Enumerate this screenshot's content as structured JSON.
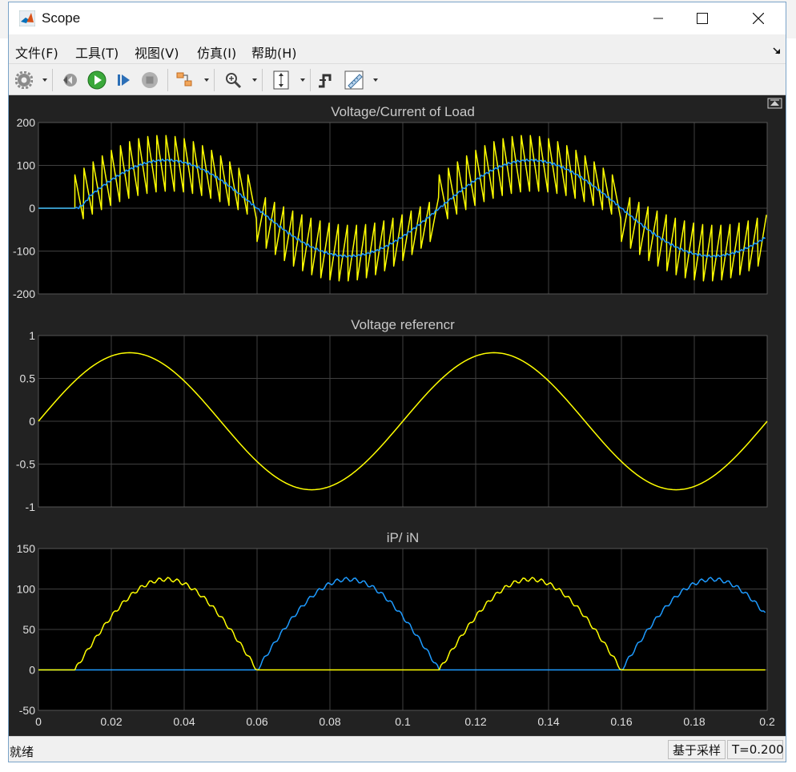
{
  "window": {
    "title": "Scope"
  },
  "menu": [
    "文件(F)",
    "工具(T)",
    "视图(V)",
    "仿真(I)",
    "帮助(H)"
  ],
  "toolbar": {
    "icons": [
      "gear-icon",
      "restore-icon",
      "run-icon",
      "step-forward-icon",
      "stop-icon",
      "highlight-block-icon",
      "zoom-icon",
      "autoscale-icon",
      "triggers-icon",
      "measurements-icon"
    ]
  },
  "plots": [
    {
      "title": "Voltage/Current of Load",
      "yticks": [
        "200",
        "100",
        "0",
        "-100",
        "-200"
      ]
    },
    {
      "title": "Voltage referencr",
      "yticks": [
        "1",
        "0.5",
        "0",
        "-0.5",
        "-1"
      ]
    },
    {
      "title": "iP/ iN",
      "yticks": [
        "150",
        "100",
        "50",
        "0",
        "-50"
      ]
    }
  ],
  "xticks": [
    "0",
    "0.02",
    "0.04",
    "0.06",
    "0.08",
    "0.1",
    "0.12",
    "0.14",
    "0.16",
    "0.18",
    "0.2"
  ],
  "status": {
    "left": "就绪",
    "mode": "基于采样",
    "time": "T=0.200"
  },
  "colors": {
    "background": "#222222",
    "axes": "#000000",
    "grid": "#404040",
    "yellow": "#ffff00",
    "blue": "#1e9bff"
  },
  "chart_data": [
    {
      "type": "line",
      "title": "Voltage/Current of Load",
      "xlim": [
        0,
        0.2
      ],
      "ylim": [
        -200,
        200
      ],
      "grid": true,
      "series": [
        {
          "color": "#ffff00",
          "x": [
            0,
            0.01,
            0.025,
            0.06,
            0.075,
            0.11,
            0.125,
            0.16,
            0.175,
            0.2
          ],
          "values": [
            0,
            0,
            170,
            0,
            -170,
            0,
            170,
            0,
            -170,
            0
          ],
          "note_shape": "sawtooth switching voltage bounded by envelope"
        },
        {
          "color": "#1e9bff",
          "x": [
            0,
            0.01,
            0.035,
            0.06,
            0.085,
            0.11,
            0.135,
            0.16,
            0.185,
            0.2
          ],
          "values": [
            0,
            0,
            112,
            0,
            -112,
            0,
            112,
            0,
            -112,
            -65
          ]
        }
      ]
    },
    {
      "type": "line",
      "title": "Voltage referencr",
      "xlim": [
        0,
        0.2
      ],
      "ylim": [
        -1,
        1
      ],
      "grid": true,
      "series": [
        {
          "color": "#ffff00",
          "x": [
            0,
            0.025,
            0.05,
            0.075,
            0.1,
            0.125,
            0.15,
            0.175,
            0.2
          ],
          "values": [
            0,
            0.8,
            0,
            -0.8,
            0,
            0.8,
            0,
            -0.8,
            0
          ]
        }
      ]
    },
    {
      "type": "line",
      "title": "iP/ iN",
      "xlim": [
        0,
        0.2
      ],
      "ylim": [
        -50,
        150
      ],
      "grid": true,
      "series": [
        {
          "color": "#ffff00",
          "x": [
            0,
            0.01,
            0.035,
            0.06,
            0.11,
            0.135,
            0.16,
            0.2
          ],
          "values": [
            0,
            0,
            112,
            0,
            0,
            112,
            0,
            0
          ]
        },
        {
          "color": "#1e9bff",
          "x": [
            0,
            0.06,
            0.085,
            0.11,
            0.16,
            0.185,
            0.2
          ],
          "values": [
            0,
            0,
            112,
            0,
            0,
            112,
            65
          ]
        }
      ]
    }
  ]
}
